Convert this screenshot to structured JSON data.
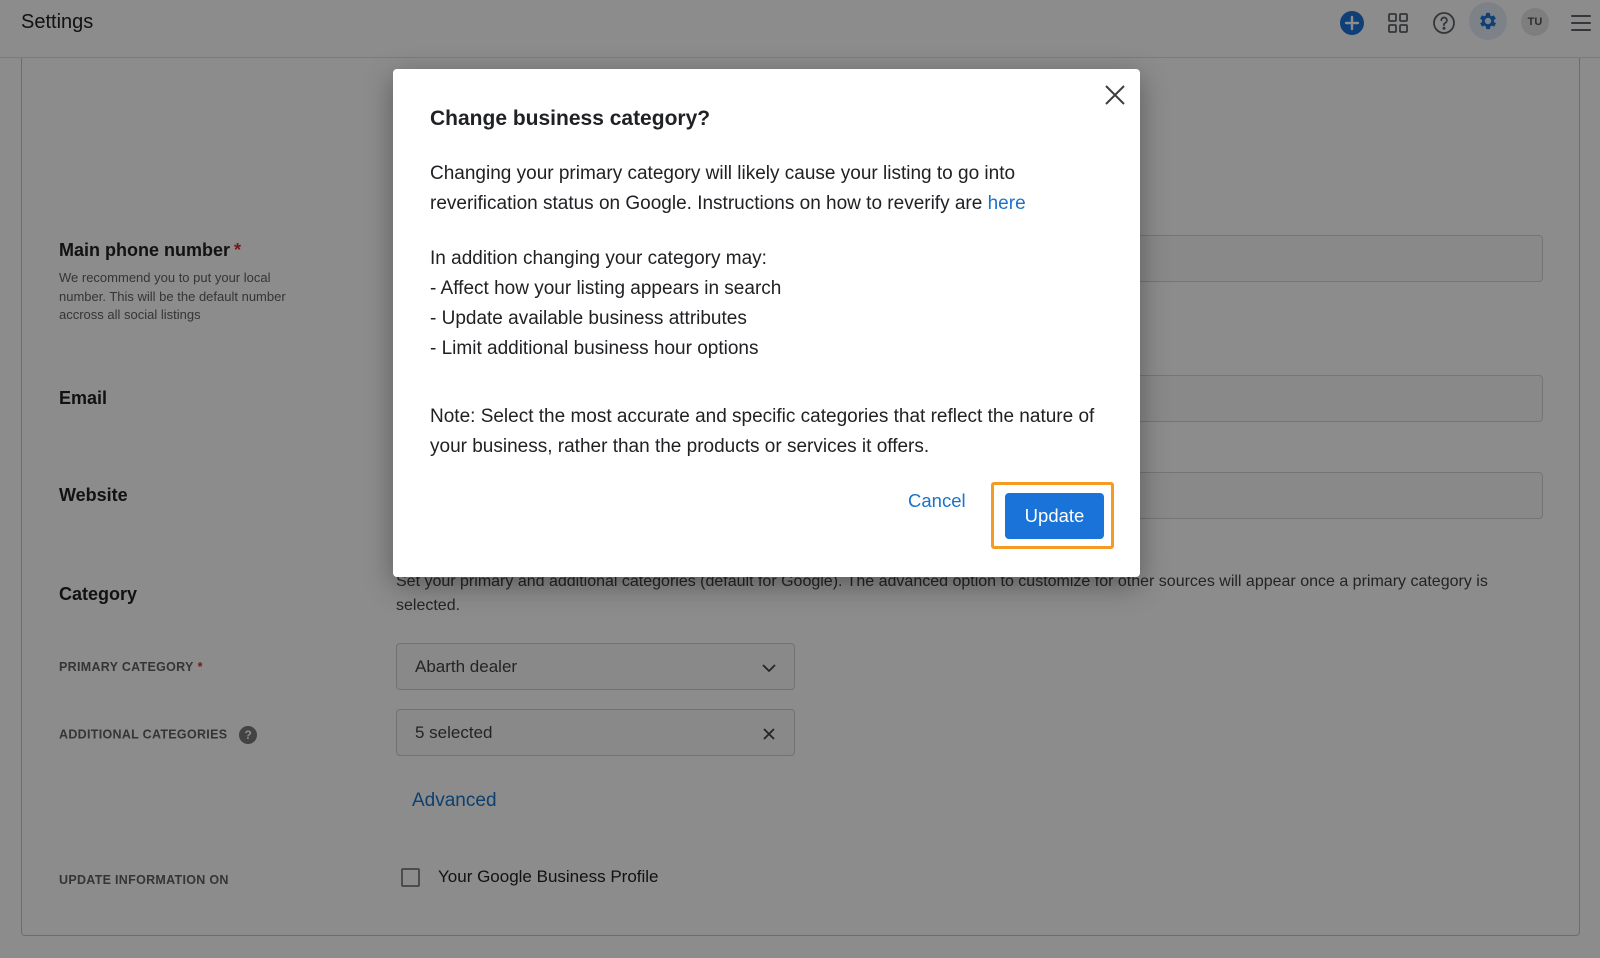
{
  "app": {
    "title": "Settings"
  },
  "topbar": {
    "icons": [
      "plus-circle-icon",
      "apps-grid-icon",
      "help-icon",
      "gear-icon"
    ],
    "avatar_initials": "TU"
  },
  "form": {
    "main_phone": {
      "label": "Main phone number",
      "required_mark": "*",
      "description": "We recommend you to put your local number. This will be the default number accross all social listings"
    },
    "email": {
      "label": "Email"
    },
    "website": {
      "label": "Website"
    },
    "category": {
      "label": "Category",
      "description": "Set your primary and additional categories (default for Google). The advanced option to customize for other sources will appear once a primary category is selected.",
      "primary_label": "PRIMARY CATEGORY",
      "primary_required_mark": "*",
      "primary_value": "Abarth dealer",
      "additional_label": "ADDITIONAL CATEGORIES",
      "additional_help": "?",
      "additional_value": "5 selected",
      "advanced_link": "Advanced"
    },
    "update_on": {
      "label": "UPDATE INFORMATION ON",
      "option_label": "Your Google Business Profile",
      "checked": false
    }
  },
  "dialog": {
    "title": "Change business category?",
    "paragraph1": "Changing your primary category will likely cause your listing to go into reverification status on Google. Instructions on how to reverify are",
    "paragraph1_link": "here",
    "intro": "In addition changing your category may:",
    "bullets": [
      "- Affect how your listing appears in search",
      "- Update available business attributes",
      "- Limit additional business hour options"
    ],
    "note": "Note: Select the most accurate and specific categories that reflect the nature of your business, rather than the products or services it offers.",
    "cancel_label": "Cancel",
    "update_label": "Update"
  },
  "colors": {
    "accent": "#1a73d8",
    "link": "#1a73c9",
    "focus_ring": "#f59a23",
    "required": "#d32f2f"
  }
}
